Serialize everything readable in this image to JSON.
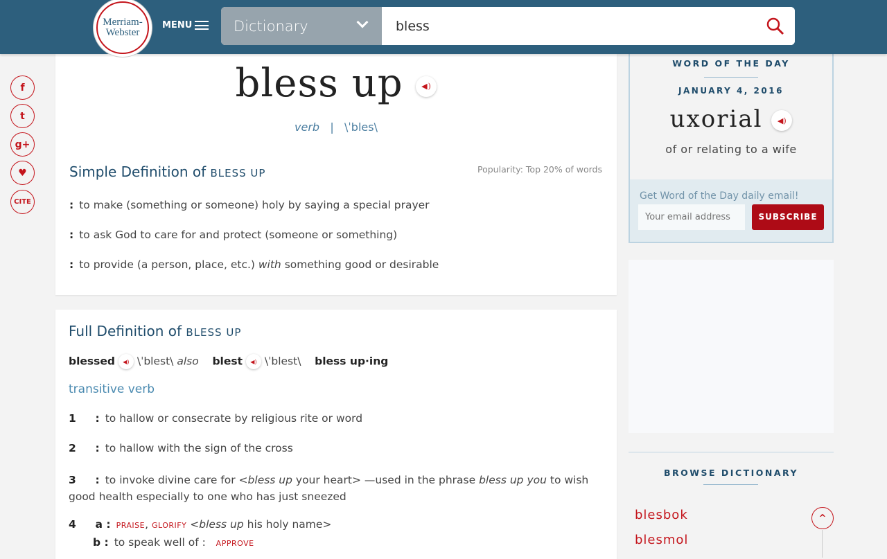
{
  "header": {
    "logo_line1": "Merriam-",
    "logo_line2": "Webster",
    "menu_label": "MENU",
    "dictionary_select": "Dictionary",
    "search_value": "bless"
  },
  "social": [
    "f",
    "t",
    "g+",
    "♥",
    "CITE"
  ],
  "entry": {
    "headword": "bless up",
    "pos": "verb",
    "separator": "|",
    "pronunciation": "\\ˈbles\\"
  },
  "simple": {
    "title": "Simple Definition of",
    "title_word": "BLESS UP",
    "popularity": "Popularity: Top 20% of words",
    "defs": [
      "to make (something or someone) holy by saying a special prayer",
      "to ask God to care for and protect (someone or something)",
      "to provide (a person, place, etc.) ",
      "with",
      " something good or desirable"
    ]
  },
  "full": {
    "title": "Full Definition of",
    "title_word": "BLESS UP",
    "forms": {
      "f1": "blessed",
      "p1": "\\ˈblest\\",
      "also": "also",
      "f2": "blest",
      "p2": "\\ˈblest\\",
      "f3": "bless up·ing"
    },
    "fl": "transitive verb",
    "senses": [
      {
        "num": "1",
        "text": "to hallow or consecrate by religious rite or word"
      },
      {
        "num": "2",
        "text": "to hallow with the sign of the cross"
      },
      {
        "num": "3",
        "t1": "to invoke divine care for <",
        "i1": "bless up",
        "t2": " your heart> —used in the phrase ",
        "i2": "bless up you",
        "t3": " to wish good health especially to one who has just sneezed"
      },
      {
        "num": "4",
        "a": "a :",
        "x1": "PRAISE",
        "comma": ",",
        "x2": "GLORIFY",
        "t1": " <",
        "i1": "bless up",
        "t2": " his holy name>",
        "b": "b :",
        "bt": "to speak well of :",
        "x3": "APPROVE"
      }
    ]
  },
  "wotd": {
    "heading": "WORD OF THE DAY",
    "date": "JANUARY 4, 2016",
    "word": "uxorial",
    "definition": "of or relating to a wife",
    "email_prompt": "Get Word of the Day daily email!",
    "email_placeholder": "Your email address",
    "subscribe": "SUBSCRIBE"
  },
  "browse": {
    "heading": "BROWSE DICTIONARY",
    "words": [
      "blesbok",
      "blesmol"
    ]
  }
}
